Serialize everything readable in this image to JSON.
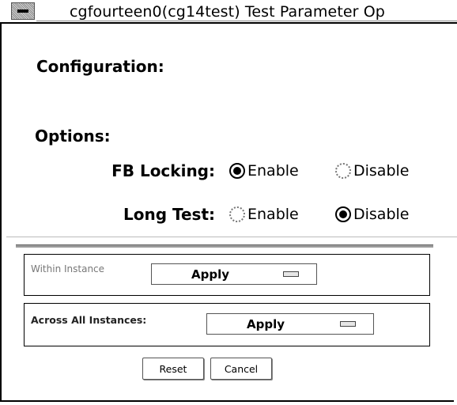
{
  "window": {
    "title": "cgfourteen0(cg14test) Test Parameter Op"
  },
  "configuration": {
    "heading": "Configuration:"
  },
  "options": {
    "heading": "Options:",
    "fb_locking": {
      "label": "FB Locking:",
      "enable_label": "Enable",
      "disable_label": "Disable",
      "selected": "Enable"
    },
    "long_test": {
      "label": "Long Test:",
      "enable_label": "Enable",
      "disable_label": "Disable",
      "selected": "Disable"
    }
  },
  "scope": {
    "within_label": "Within Instance",
    "within_apply": "Apply",
    "across_label": "Across All Instances:",
    "across_apply": "Apply"
  },
  "buttons": {
    "reset": "Reset",
    "cancel": "Cancel"
  }
}
